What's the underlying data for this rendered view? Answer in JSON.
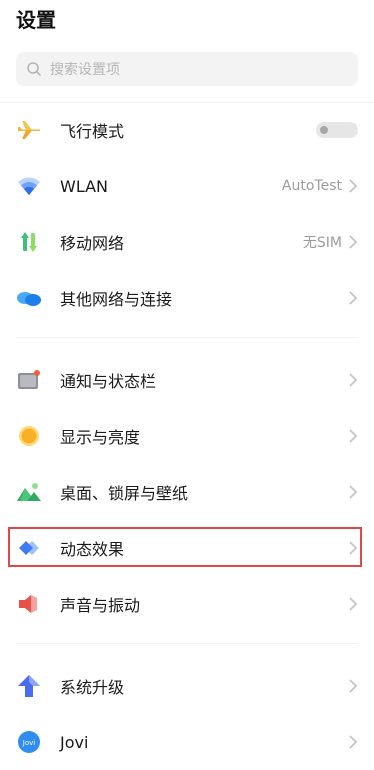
{
  "header": {
    "title": "设置"
  },
  "search": {
    "placeholder": "搜索设置项"
  },
  "group1": [
    {
      "label": "飞行模式",
      "icon": "airplane-icon",
      "toggle": "off"
    },
    {
      "label": "WLAN",
      "icon": "wifi-icon",
      "value": "AutoTest"
    },
    {
      "label": "移动网络",
      "icon": "mobile-network-icon",
      "value": "无SIM"
    },
    {
      "label": "其他网络与连接",
      "icon": "cloud-network-icon"
    }
  ],
  "group2": [
    {
      "label": "通知与状态栏",
      "icon": "notification-icon"
    },
    {
      "label": "显示与亮度",
      "icon": "brightness-icon"
    },
    {
      "label": "桌面、锁屏与壁纸",
      "icon": "wallpaper-icon"
    },
    {
      "label": "动态效果",
      "icon": "dynamic-effect-icon",
      "highlighted": true
    },
    {
      "label": "声音与振动",
      "icon": "speaker-icon"
    }
  ],
  "group3": [
    {
      "label": "系统升级",
      "icon": "upgrade-arrow-icon"
    },
    {
      "label": "Jovi",
      "icon": "jovi-icon",
      "icon_text": "Jovi"
    }
  ],
  "colors": {
    "highlight_border": "#e04848",
    "accent_blue": "#3d7bf2"
  }
}
